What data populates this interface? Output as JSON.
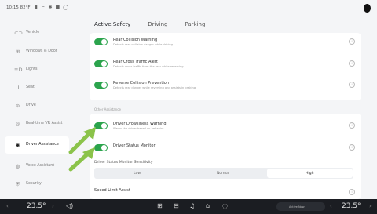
{
  "status_bar": {
    "text": "10:15 82°F"
  },
  "sidebar": {
    "items": [
      {
        "label": "Vehicle",
        "icon": "car-icon"
      },
      {
        "label": "Windows & Door",
        "icon": "window-icon"
      },
      {
        "label": "Lights",
        "icon": "light-icon"
      },
      {
        "label": "Seat",
        "icon": "seat-icon"
      },
      {
        "label": "Drive",
        "icon": "drive-icon"
      },
      {
        "label": "Real-time VR Assist",
        "icon": "camera-icon"
      },
      {
        "label": "Driver Assistance",
        "icon": "steering-icon"
      },
      {
        "label": "Voice Assistant",
        "icon": "microphone-icon"
      },
      {
        "label": "Security",
        "icon": "shield-icon"
      }
    ]
  },
  "tabs": [
    {
      "label": "Active Safety"
    },
    {
      "label": "Driving"
    },
    {
      "label": "Parking"
    }
  ],
  "card1": {
    "rows": [
      {
        "title": "Rear Collision Warning",
        "desc": "Detects rear collision danger while driving"
      },
      {
        "title": "Rear Cross Traffic Alert",
        "desc": "Detects cross traffic from the rear while reversing"
      },
      {
        "title": "Reverse Collision Prevention",
        "desc": "Detects rear danger while reversing and assists in braking"
      }
    ]
  },
  "section2_label": "Other Assistance",
  "card2": {
    "rows": [
      {
        "title": "Driver Drowsiness Warning",
        "desc": "Warns the driver based on behavior"
      },
      {
        "title": "Driver Status Monitor",
        "desc": ""
      },
      {
        "title": "Speed Limit Assist",
        "desc": ""
      }
    ],
    "sensitivity_label": "Driver Status Monitor Sensitivity",
    "sensitivity_options": [
      "Low",
      "Normal",
      "High"
    ],
    "sensitivity_selected": "High"
  },
  "bottom_bar": {
    "temp_left": "23.5°",
    "temp_right": "23.5°",
    "media_text": "Active Now"
  },
  "colors": {
    "toggle_on": "#2ca44d",
    "arrow": "#8bc34a",
    "bar": "#1b1d22"
  }
}
